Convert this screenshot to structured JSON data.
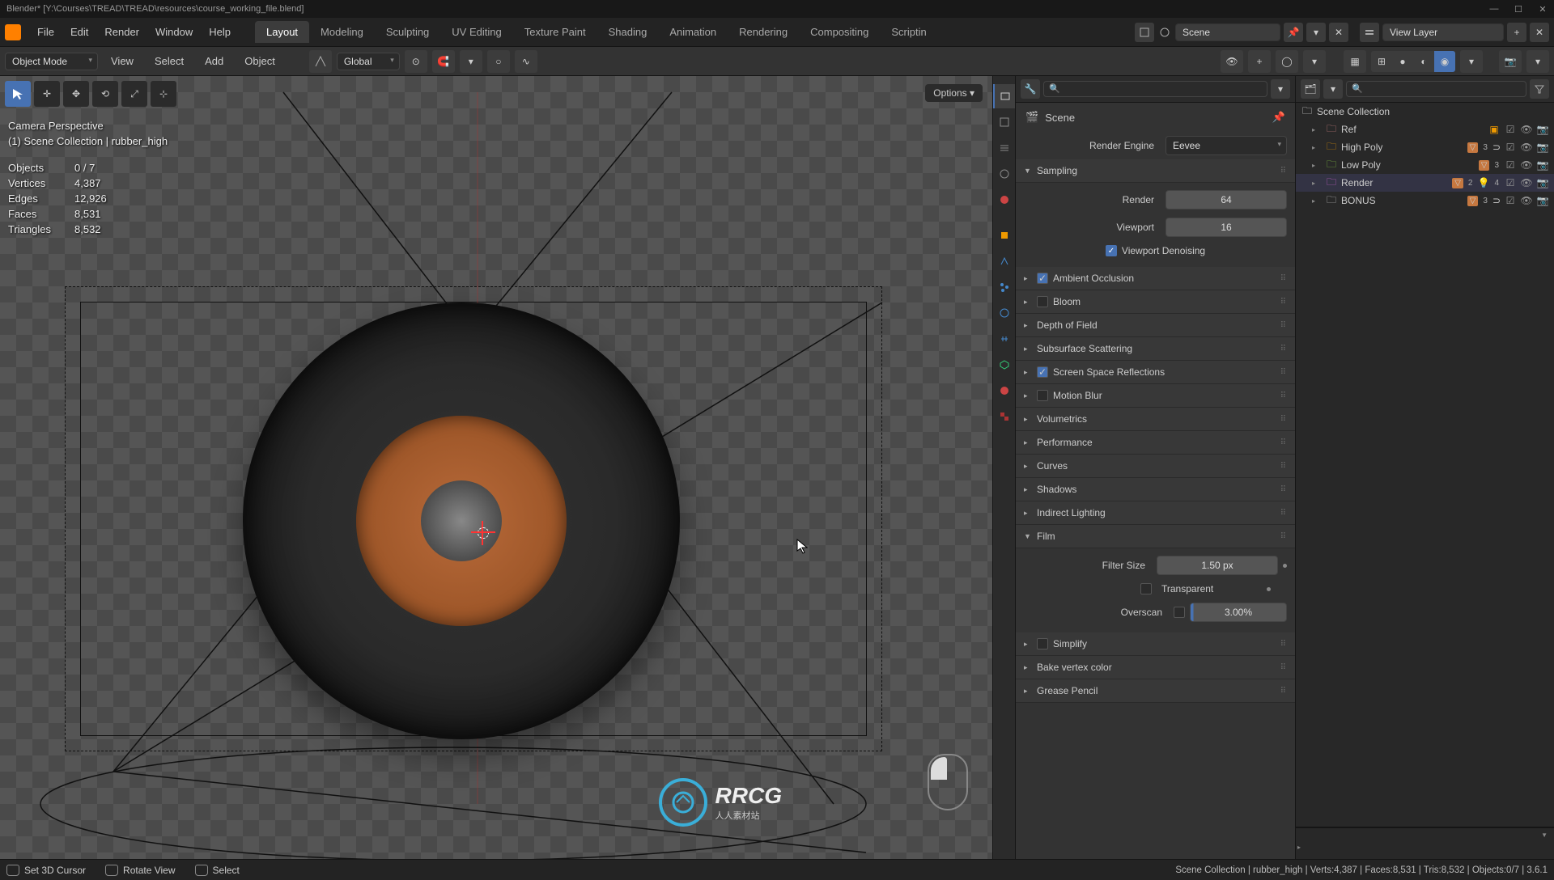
{
  "title": "Blender* [Y:\\Courses\\TREAD\\TREAD\\resources\\course_working_file.blend]",
  "menu": {
    "file": "File",
    "edit": "Edit",
    "render": "Render",
    "window": "Window",
    "help": "Help"
  },
  "tabs": {
    "layout": "Layout",
    "modeling": "Modeling",
    "sculpting": "Sculpting",
    "uv": "UV Editing",
    "texture": "Texture Paint",
    "shading": "Shading",
    "animation": "Animation",
    "rendering": "Rendering",
    "compositing": "Compositing",
    "scripting": "Scriptin"
  },
  "scene_dropdown": "Scene",
  "viewlayer_dropdown": "View Layer",
  "mode_dropdown": "Object Mode",
  "header_menu": {
    "view": "View",
    "select": "Select",
    "add": "Add",
    "object": "Object"
  },
  "orient": "Global",
  "options_label": "Options",
  "stats": {
    "cam": "Camera Perspective",
    "path": "(1) Scene Collection | rubber_high",
    "objects_label": "Objects",
    "objects": "0 / 7",
    "vertices_label": "Vertices",
    "vertices": "4,387",
    "edges_label": "Edges",
    "edges": "12,926",
    "faces_label": "Faces",
    "faces": "8,531",
    "tris_label": "Triangles",
    "tris": "8,532"
  },
  "watermark": {
    "main": "RRCG",
    "sub": "人人素材站"
  },
  "props": {
    "scene_label": "Scene",
    "render_engine_label": "Render Engine",
    "render_engine": "Eevee",
    "sampling_label": "Sampling",
    "render_label": "Render",
    "render_val": "64",
    "viewport_label": "Viewport",
    "viewport_val": "16",
    "vp_denoise": "Viewport Denoising",
    "ao": "Ambient Occlusion",
    "bloom": "Bloom",
    "dof": "Depth of Field",
    "sss": "Subsurface Scattering",
    "ssr": "Screen Space Reflections",
    "mblur": "Motion Blur",
    "volumetrics": "Volumetrics",
    "performance": "Performance",
    "curves": "Curves",
    "shadows": "Shadows",
    "indirect": "Indirect Lighting",
    "film": "Film",
    "filter_size_label": "Filter Size",
    "filter_size": "1.50 px",
    "transparent": "Transparent",
    "overscan_label": "Overscan",
    "overscan": "3.00%",
    "simplify": "Simplify",
    "bake_vc": "Bake vertex color",
    "gp": "Grease Pencil"
  },
  "outliner": {
    "root": "Scene Collection",
    "ref": "Ref",
    "high": "High Poly",
    "low": "Low Poly",
    "render": "Render",
    "bonus": "BONUS",
    "counts": {
      "high": "3",
      "low": "3",
      "render_a": "2",
      "render_b": "4",
      "bonus": "3"
    }
  },
  "statusbar": {
    "cursor": "Set 3D Cursor",
    "rotate": "Rotate View",
    "select": "Select",
    "right": "Scene Collection | rubber_high | Verts:4,387 | Faces:8,531 | Tris:8,532 | Objects:0/7 | 3.6.1"
  }
}
